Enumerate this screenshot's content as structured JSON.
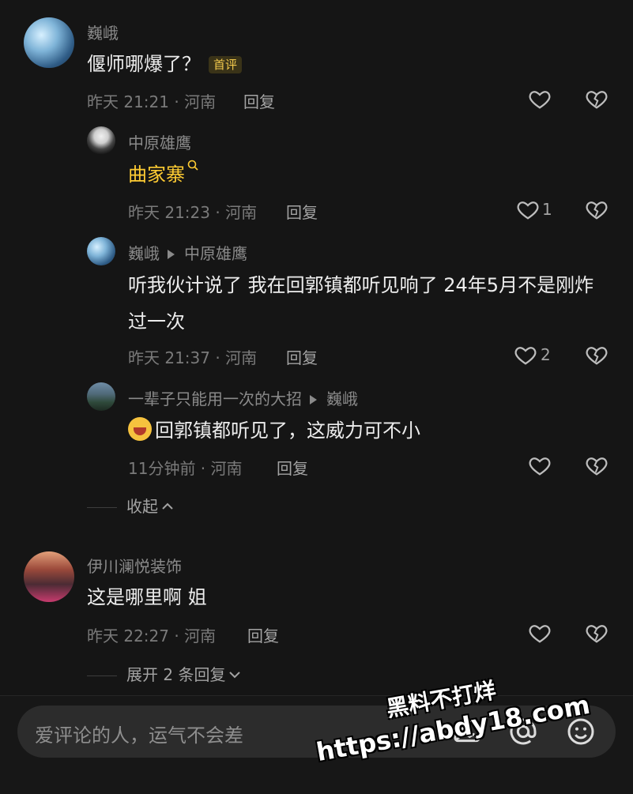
{
  "comments": [
    {
      "user": "巍峨",
      "text": "偃师哪爆了？",
      "badge": "首评",
      "time": "昨天 21:21 · 河南",
      "reply_label": "回复",
      "likes": "",
      "replies": [
        {
          "user": "中原雄鹰",
          "text": "曲家寨",
          "time": "昨天 21:23 · 河南",
          "reply_label": "回复",
          "likes": "1"
        },
        {
          "user": "巍峨",
          "reply_to": "中原雄鹰",
          "text": "听我伙计说了 我在回郭镇都听见响了  24年5月不是刚炸过一次",
          "time": "昨天 21:37 · 河南",
          "reply_label": "回复",
          "likes": "2"
        },
        {
          "user": "一辈子只能用一次的大招",
          "reply_to": "巍峨",
          "text": "回郭镇都听见了，这威力可不小",
          "time": "11分钟前 · 河南",
          "reply_label": "回复",
          "likes": ""
        }
      ],
      "toggle_label": "收起"
    },
    {
      "user": "伊川澜悦装饰",
      "text": "这是哪里啊 姐",
      "time": "昨天 22:27 · 河南",
      "reply_label": "回复",
      "likes": "",
      "toggle_label": "展开 2 条回复"
    }
  ],
  "input": {
    "placeholder": "爱评论的人，运气不会差"
  },
  "watermark": {
    "line1": "黑料不打烊",
    "line2": "https://abdy18.com"
  }
}
